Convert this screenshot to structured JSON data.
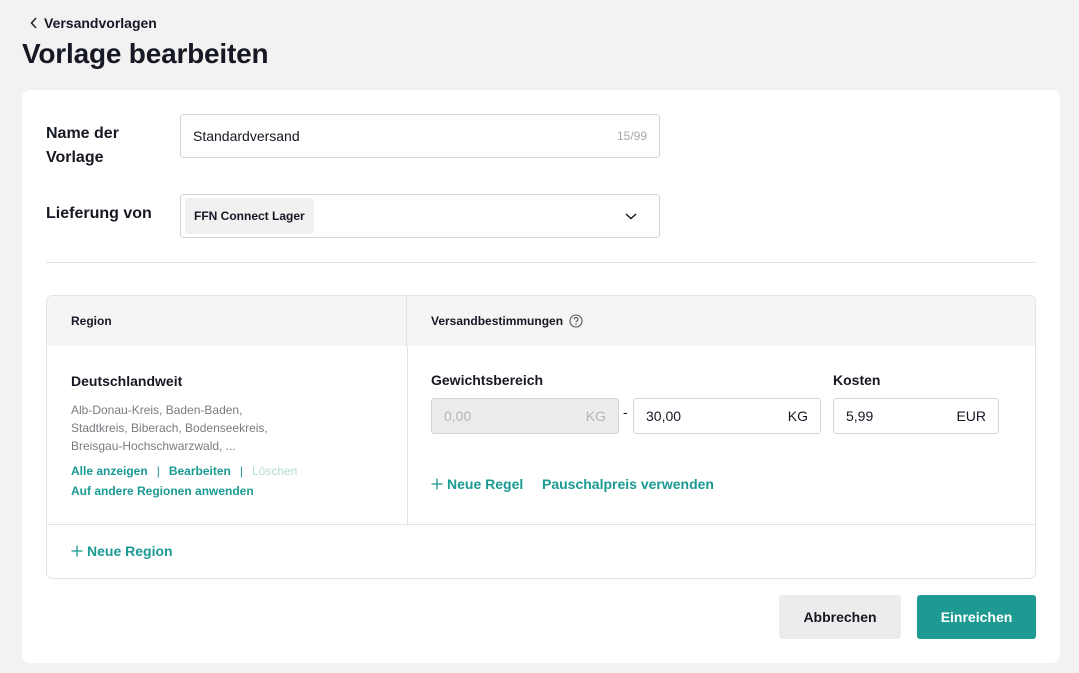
{
  "nav": {
    "back_label": "Versandvorlagen"
  },
  "page": {
    "title": "Vorlage bearbeiten"
  },
  "form": {
    "name_label_line1": "Name der",
    "name_label_line2": "Vorlage",
    "name_value": "Standardversand",
    "name_counter": "15/99",
    "delivery_label": "Lieferung von",
    "delivery_value": "FFN Connect Lager"
  },
  "table": {
    "headers": {
      "region": "Region",
      "rules": "Versandbestimmungen"
    },
    "region": {
      "name": "Deutschlandweit",
      "list_lines": [
        "Alb-Donau-Kreis, Baden-Baden,",
        "Stadtkreis, Biberach, Bodenseekreis,",
        "Breisgau-Hochschwarzwald, ..."
      ],
      "actions": {
        "show_all": "Alle anzeigen",
        "edit": "Bearbeiten",
        "delete": "Löschen",
        "separator": "|",
        "apply_other": "Auf andere Regionen anwenden"
      }
    },
    "rule": {
      "weight_label": "Gewichtsbereich",
      "weight_from": "0,00",
      "weight_to": "30,00",
      "weight_unit": "KG",
      "range_separator": "-",
      "cost_label": "Kosten",
      "cost_value": "5,99",
      "cost_unit": "EUR",
      "new_rule": "Neue Regel",
      "flat_rate": "Pauschalpreis verwenden"
    },
    "new_region": "Neue Region"
  },
  "footer": {
    "cancel_label": "Abbrechen",
    "submit_label": "Einreichen"
  },
  "colors": {
    "accent": "#1f9a92",
    "link": "#1a9a93"
  }
}
